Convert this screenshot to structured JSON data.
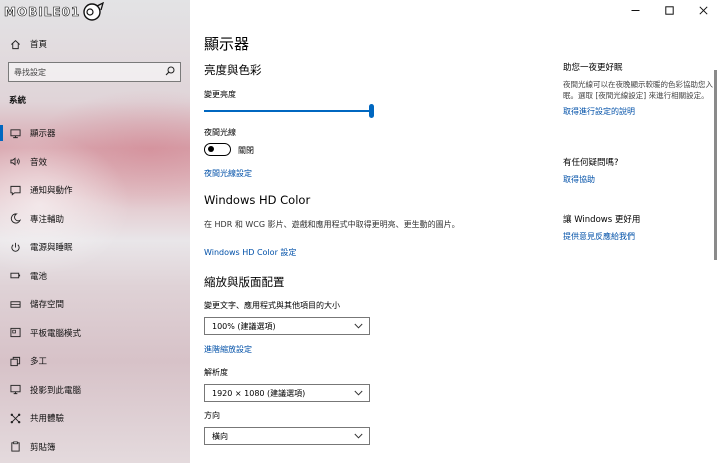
{
  "logo": {
    "text": "MOBILE01"
  },
  "window": {
    "minimize": "minimize",
    "maximize": "maximize",
    "close": "close"
  },
  "sidebar": {
    "home": "首頁",
    "search_placeholder": "尋找設定",
    "section": "系統",
    "items": [
      {
        "label": "顯示器",
        "icon": "display-icon",
        "active": true
      },
      {
        "label": "音效",
        "icon": "sound-icon"
      },
      {
        "label": "通知與動作",
        "icon": "notifications-icon"
      },
      {
        "label": "專注輔助",
        "icon": "focus-assist-icon"
      },
      {
        "label": "電源與睡眠",
        "icon": "power-icon"
      },
      {
        "label": "電池",
        "icon": "battery-icon"
      },
      {
        "label": "儲存空間",
        "icon": "storage-icon"
      },
      {
        "label": "平板電腦模式",
        "icon": "tablet-mode-icon"
      },
      {
        "label": "多工",
        "icon": "multitasking-icon"
      },
      {
        "label": "投影到此電腦",
        "icon": "project-icon"
      },
      {
        "label": "共用體驗",
        "icon": "shared-experiences-icon"
      },
      {
        "label": "剪貼簿",
        "icon": "clipboard-icon"
      }
    ]
  },
  "main": {
    "title": "顯示器",
    "brightness": {
      "heading": "亮度與色彩",
      "slider_label": "變更亮度",
      "value_percent": 100,
      "night_light_label": "夜間光線",
      "night_light_state": "關閉",
      "night_light_link": "夜間光線設定"
    },
    "hd_color": {
      "heading": "Windows HD Color",
      "desc": "在 HDR 和 WCG 影片、遊戲和應用程式中取得更明亮、更生動的圖片。",
      "link": "Windows HD Color 設定"
    },
    "scale": {
      "heading": "縮放與版面配置",
      "scale_label": "變更文字、應用程式與其他項目的大小",
      "scale_value": "100% (建議選項)",
      "advanced_link": "進階縮放設定",
      "resolution_label": "解析度",
      "resolution_value": "1920 × 1080 (建議選項)",
      "orientation_label": "方向",
      "orientation_value": "橫向"
    }
  },
  "right": {
    "sleep": {
      "title": "助您一夜更好眠",
      "text": "夜間光線可以在夜晚顯示較暖的色彩協助您入眠。選取 [夜間光線設定] 來進行相關設定。",
      "link": "取得進行設定的說明"
    },
    "help": {
      "title": "有任何疑問嗎?",
      "link": "取得協助"
    },
    "feedback": {
      "title": "讓 Windows 更好用",
      "link": "提供意見反應給我們"
    }
  },
  "colors": {
    "accent": "#0067c0",
    "link": "#0050a8"
  }
}
